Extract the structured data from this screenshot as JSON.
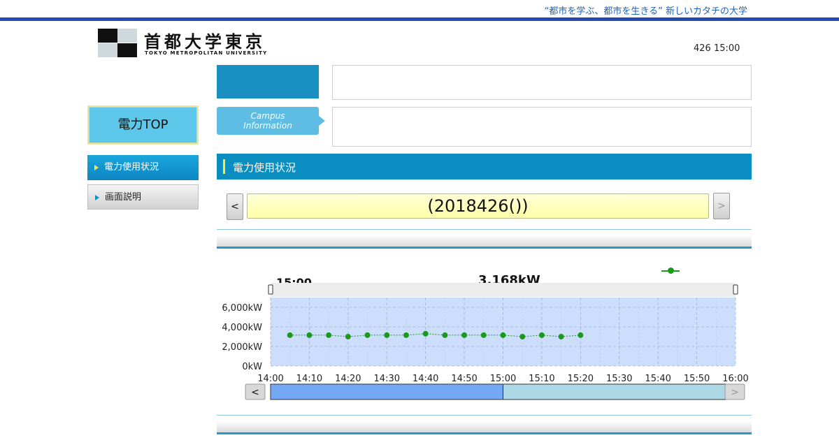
{
  "header": {
    "tagline": "“都市を学ぶ、都市を生きる” 新しいカタチの大学",
    "logo_jp": "首都大学東京",
    "logo_en": "TOKYO METROPOLITAN UNIVERSITY",
    "datetime": "426 15:00"
  },
  "campus_tab": {
    "line1": "Campus",
    "line2": "Information"
  },
  "sidebar": {
    "power_top_label": "電力TOP",
    "items": [
      {
        "label": "電力使用状況",
        "active": true
      },
      {
        "label": "画面説明",
        "active": false
      }
    ]
  },
  "section": {
    "title": "電力使用状況"
  },
  "date_nav": {
    "prev_label": "<",
    "next_label": ">",
    "date_label": "(2018426())"
  },
  "overlay": {
    "time_partial": "15:00",
    "kw_partial": "3,168kW"
  },
  "chart_controls": {
    "prev_label": "<",
    "next_label": ">",
    "slider_position": 0.5
  },
  "colors": {
    "series": "#1a9a1a",
    "plot_bg": "#cdddfc",
    "accent": "#0a8ec2",
    "date_box": "#ffffb8"
  },
  "chart_data": {
    "type": "line",
    "x_ticks": [
      "14:00",
      "14:10",
      "14:20",
      "14:30",
      "14:40",
      "14:50",
      "15:00",
      "15:10",
      "15:20",
      "15:30",
      "15:40",
      "15:50",
      "16:00"
    ],
    "y_ticks": [
      "0kW",
      "2,000kW",
      "4,000kW",
      "6,000kW"
    ],
    "ylim": [
      0,
      7000
    ],
    "xlim": [
      "14:00",
      "16:00"
    ],
    "grid": true,
    "series": [
      {
        "x": [
          "14:05",
          "14:10",
          "14:15",
          "14:20",
          "14:25",
          "14:30",
          "14:35",
          "14:40",
          "14:45",
          "14:50",
          "14:55",
          "15:00",
          "15:05",
          "15:10",
          "15:15",
          "15:20"
        ],
        "values": [
          3150,
          3150,
          3150,
          3000,
          3150,
          3150,
          3150,
          3300,
          3150,
          3150,
          3150,
          3150,
          3000,
          3150,
          3000,
          3150
        ]
      }
    ]
  }
}
